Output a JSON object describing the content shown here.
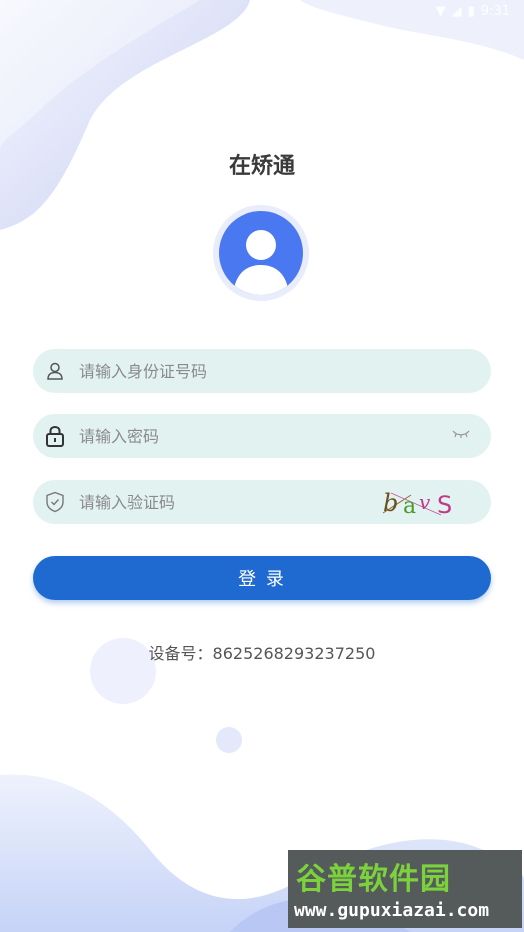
{
  "status_bar": {
    "time": "9:31"
  },
  "app": {
    "title": "在矫通"
  },
  "form": {
    "id_placeholder": "请输入身份证号码",
    "password_placeholder": "请输入密码",
    "captcha_placeholder": "请输入验证码",
    "captcha_text": "bavS",
    "login_label": "登 录"
  },
  "device": {
    "label": "设备号：8625268293237250"
  },
  "watermark": {
    "title": "谷普软件园",
    "url": "www.gupuxiazai.com"
  },
  "colors": {
    "primary": "#1f6ad0",
    "field_bg": "#e2f2f1",
    "avatar": "#4a78f0"
  }
}
